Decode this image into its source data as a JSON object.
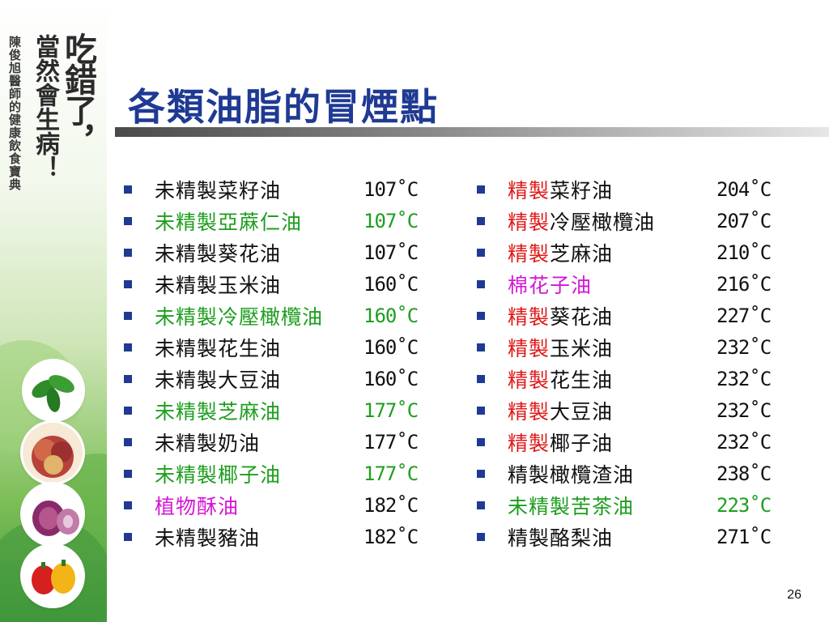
{
  "sidebar": {
    "book_title_big": "吃錯了，",
    "book_title_mid": "當然會生病！",
    "book_title_small": "陳俊旭醫師的健康飲食寶典"
  },
  "slide": {
    "title": "各類油脂的冒煙點",
    "page_number": "26"
  },
  "colors": {
    "title": "#1f3a93",
    "bullet": "#1f3a93",
    "green": "#1e9e1e",
    "magenta": "#d417d4",
    "red": "#e01a1a",
    "black": "#111111"
  },
  "left_list": [
    {
      "name": "未精製菜籽油",
      "temp": "107˚C",
      "color": "black"
    },
    {
      "name": "未精製亞蔴仁油",
      "temp": "107˚C",
      "color": "green"
    },
    {
      "name": "未精製葵花油",
      "temp": "107˚C",
      "color": "black"
    },
    {
      "name": "未精製玉米油",
      "temp": "160˚C",
      "color": "black"
    },
    {
      "name": "未精製冷壓橄欖油",
      "temp": "160˚C",
      "color": "green"
    },
    {
      "name": "未精製花生油",
      "temp": "160˚C",
      "color": "black"
    },
    {
      "name": "未精製大豆油",
      "temp": "160˚C",
      "color": "black"
    },
    {
      "name": "未精製芝麻油",
      "temp": "177˚C",
      "color": "green"
    },
    {
      "name": "未精製奶油",
      "temp": "177˚C",
      "color": "black"
    },
    {
      "name": "未精製椰子油",
      "temp": "177˚C",
      "color": "green"
    },
    {
      "name": "植物酥油",
      "temp": "182˚C",
      "color": "magenta"
    },
    {
      "name": "未精製豬油",
      "temp": "182˚C",
      "color": "black"
    }
  ],
  "right_list": [
    {
      "prefix": "精製",
      "name": "菜籽油",
      "temp": "204˚C"
    },
    {
      "prefix": "精製",
      "name": "冷壓橄欖油",
      "temp": "207˚C"
    },
    {
      "prefix": "精製",
      "name": "芝麻油",
      "temp": "210˚C"
    },
    {
      "prefix": "",
      "name": "棉花子油",
      "temp": "216˚C",
      "color": "magenta"
    },
    {
      "prefix": "精製",
      "name": "葵花油",
      "temp": "227˚C"
    },
    {
      "prefix": "精製",
      "name": "玉米油",
      "temp": "232˚C"
    },
    {
      "prefix": "精製",
      "name": "花生油",
      "temp": "232˚C"
    },
    {
      "prefix": "精製",
      "name": "大豆油",
      "temp": "232˚C"
    },
    {
      "prefix": "精製",
      "name": "椰子油",
      "temp": "232˚C"
    },
    {
      "prefix": "",
      "name": "精製橄欖渣油",
      "temp": "238˚C",
      "color": "black"
    },
    {
      "prefix": "",
      "name": "未精製苦茶油",
      "temp": "223˚C",
      "color": "green"
    },
    {
      "prefix": "",
      "name": "精製酪梨油",
      "temp": "271˚C",
      "color": "black"
    }
  ]
}
